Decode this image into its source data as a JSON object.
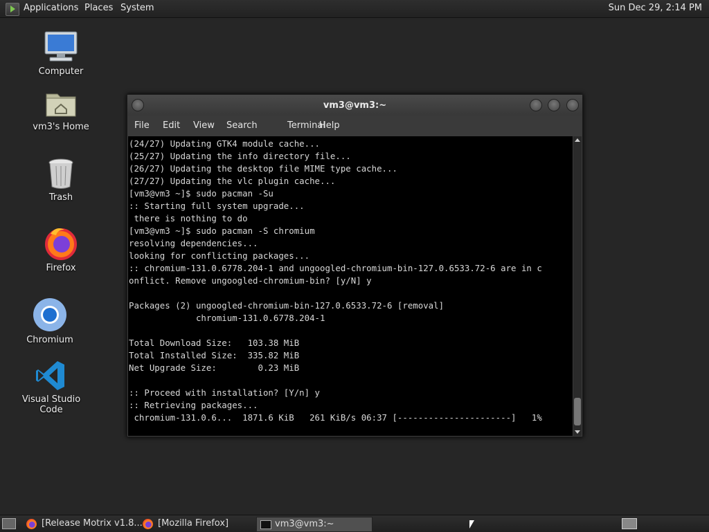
{
  "top_panel": {
    "menus": [
      "Applications",
      "Places",
      "System"
    ],
    "clock": "Sun Dec 29,  2:14 PM"
  },
  "desktop_icons": [
    {
      "label": "Computer",
      "icon": "computer-icon"
    },
    {
      "label": "vm3's Home",
      "icon": "home-folder-icon"
    },
    {
      "label": "Trash",
      "icon": "trash-icon"
    },
    {
      "label": "Firefox",
      "icon": "firefox-icon"
    },
    {
      "label": "Chromium",
      "icon": "chromium-icon"
    },
    {
      "label": "Visual Studio Code",
      "icon": "vscode-icon"
    }
  ],
  "terminal": {
    "title": "vm3@vm3:~",
    "menus": [
      "File",
      "Edit",
      "View",
      "Search",
      "Terminal",
      "Help"
    ],
    "lines": [
      "(24/27) Updating GTK4 module cache...",
      "(25/27) Updating the info directory file...",
      "(26/27) Updating the desktop file MIME type cache...",
      "(27/27) Updating the vlc plugin cache...",
      "[vm3@vm3 ~]$ sudo pacman -Su",
      ":: Starting full system upgrade...",
      " there is nothing to do",
      "[vm3@vm3 ~]$ sudo pacman -S chromium",
      "resolving dependencies...",
      "looking for conflicting packages...",
      ":: chromium-131.0.6778.204-1 and ungoogled-chromium-bin-127.0.6533.72-6 are in c",
      "onflict. Remove ungoogled-chromium-bin? [y/N] y",
      "",
      "Packages (2) ungoogled-chromium-bin-127.0.6533.72-6 [removal]",
      "             chromium-131.0.6778.204-1",
      "",
      "Total Download Size:   103.38 MiB",
      "Total Installed Size:  335.82 MiB",
      "Net Upgrade Size:        0.23 MiB",
      "",
      ":: Proceed with installation? [Y/n] y",
      ":: Retrieving packages...",
      " chromium-131.0.6...  1871.6 KiB   261 KiB/s 06:37 [----------------------]   1%"
    ]
  },
  "taskbar": {
    "tasks": [
      {
        "label": "[Release Motrix v1.8....",
        "icon": "firefox-icon",
        "active": false
      },
      {
        "label": "[Mozilla Firefox]",
        "icon": "firefox-icon",
        "active": false
      },
      {
        "label": "vm3@vm3:~",
        "icon": "terminal-icon",
        "active": true
      }
    ]
  }
}
